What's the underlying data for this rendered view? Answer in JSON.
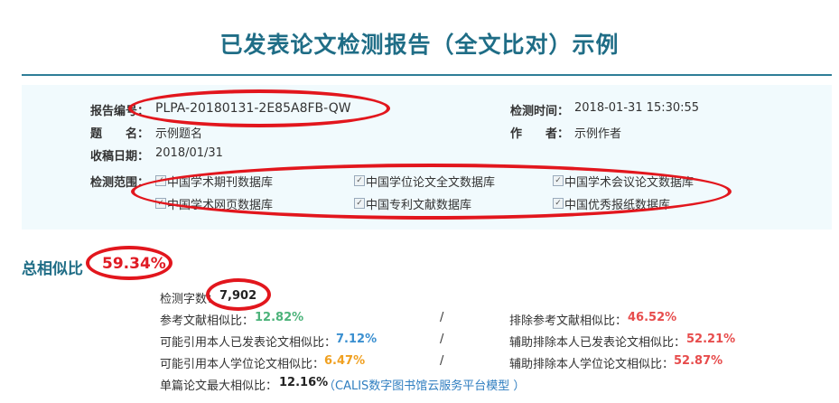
{
  "title": "已发表论文检测报告（全文比对）示例",
  "info": {
    "report_no_label": "报告编号：",
    "report_no": "PLPA-20180131-2E85A8FB-QW",
    "check_time_label": "检测时间：",
    "check_time": "2018-01-31 15:30:55",
    "subject_label": "题　　名：",
    "subject": "示例题名",
    "author_label": "作　　者：",
    "author": "示例作者",
    "received_label": "收稿日期：",
    "received": "2018/01/31",
    "scope_label": "检测范围：",
    "scope": [
      "中国学术期刊数据库",
      "中国学位论文全文数据库",
      "中国学术会议论文数据库",
      "中国学术网页数据库",
      "中国专利文献数据库",
      "中国优秀报纸数据库"
    ]
  },
  "similarity": {
    "total_label": "总相似比",
    "total_value": "59.34%",
    "word_count_label": "检测字数：",
    "word_count": "7,902",
    "separator": "/",
    "ref_label": "参考文献相似比：",
    "ref_value": "12.82%",
    "excl_ref_label": "排除参考文献相似比：",
    "excl_ref_value": "46.52%",
    "self_pub_label": "可能引用本人已发表论文相似比：",
    "self_pub_value": "7.12%",
    "excl_self_pub_label": "辅助排除本人已发表论文相似比：",
    "excl_self_pub_value": "52.21%",
    "self_thesis_label": "可能引用本人学位论文相似比：",
    "self_thesis_value": "6.47%",
    "excl_self_thesis_label": "辅助排除本人学位论文相似比：",
    "excl_self_thesis_value": "52.87%",
    "max_single_label": "单篇论文最大相似比：",
    "max_single_value": "12.16%",
    "max_single_source": "（CALIS数字图书馆云服务平台模型 ）"
  },
  "colors": {
    "title": "#1f6d86",
    "annotation": "#e2161d",
    "info_bg": "#f1fafd"
  }
}
